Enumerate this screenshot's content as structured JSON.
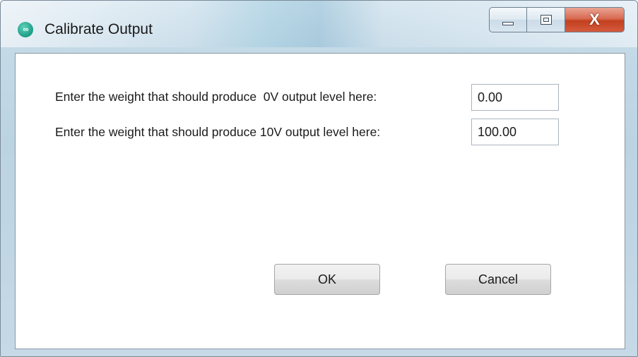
{
  "window": {
    "title": "Calibrate Output",
    "app_icon": "maxim-logo-icon",
    "caption_buttons": {
      "minimize_icon": "minimize-icon",
      "maximize_icon": "maximize-icon",
      "close_icon": "close-icon",
      "close_glyph": "X"
    }
  },
  "form": {
    "row_0v": {
      "label": "Enter the weight that should produce  0V output level here:",
      "value": "0.00"
    },
    "row_10v": {
      "label": "Enter the weight that should produce 10V output level here:",
      "value": "100.00"
    }
  },
  "buttons": {
    "ok_label": "OK",
    "cancel_label": "Cancel"
  },
  "colors": {
    "close_button": "#c2401f",
    "app_icon": "#1c9c86",
    "client_background": "#ffffff"
  }
}
